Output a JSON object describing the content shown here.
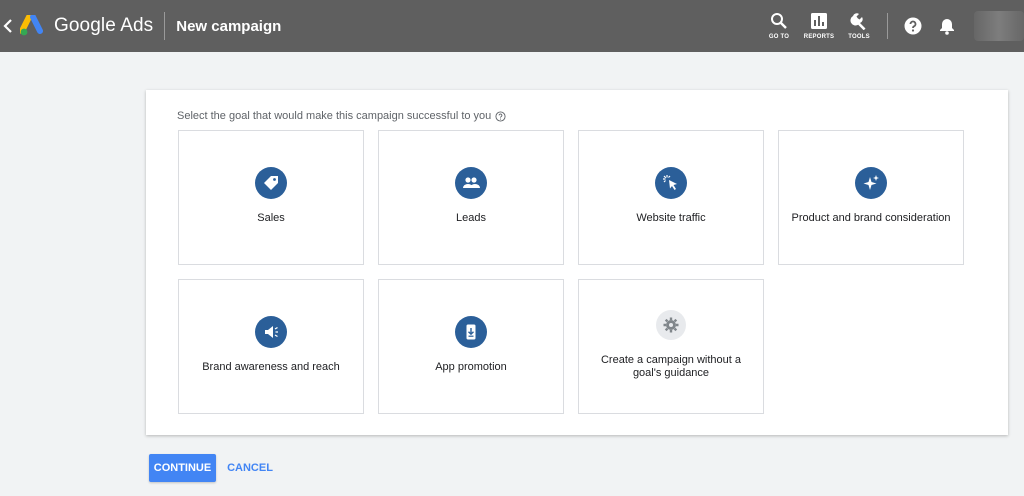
{
  "header": {
    "brand": "Google Ads",
    "title": "New campaign",
    "tools": [
      {
        "label": "GO TO",
        "icon": "search-icon"
      },
      {
        "label": "REPORTS",
        "icon": "reports-icon"
      },
      {
        "label": "TOOLS",
        "icon": "wrench-icon"
      }
    ]
  },
  "main": {
    "instruction": "Select the goal that would make this campaign successful to you",
    "goals": [
      {
        "label": "Sales",
        "icon": "tag-icon"
      },
      {
        "label": "Leads",
        "icon": "people-icon"
      },
      {
        "label": "Website traffic",
        "icon": "cursor-click-icon"
      },
      {
        "label": "Product and brand consideration",
        "icon": "sparkle-icon"
      },
      {
        "label": "Brand awareness and reach",
        "icon": "megaphone-icon"
      },
      {
        "label": "App promotion",
        "icon": "phone-download-icon"
      },
      {
        "label": "Create a campaign without a goal's guidance",
        "icon": "gear-icon"
      }
    ]
  },
  "actions": {
    "continue": "CONTINUE",
    "cancel": "CANCEL"
  },
  "colors": {
    "header_bg": "#5f5f5f",
    "accent": "#4285f4",
    "goal_icon_bg": "#2b5f99"
  }
}
